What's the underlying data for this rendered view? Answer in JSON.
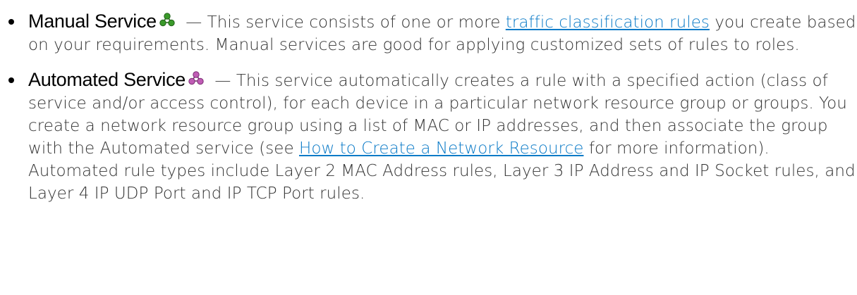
{
  "services": [
    {
      "term": "Manual Service",
      "icon": "manual-service-icon",
      "icon_color": "#3a9a2a",
      "dash": " — ",
      "text_before_link": "This service consists of one or more ",
      "link_text": "traffic classification rules",
      "text_after_link": " you create based on your requirements. Manual services are good for applying customized sets of rules to roles."
    },
    {
      "term": "Automated Service",
      "icon": "automated-service-icon",
      "icon_color": "#b24aa8",
      "dash": " — ",
      "text_before_link": "This service automatically creates a rule with a specified action (class of service and/or access control), for each device in a particular network resource group or groups. You create a network resource group using a list of MAC or IP addresses, and then associate the group with the Automated service (see ",
      "link_text": "How to Create a Network Resource",
      "text_after_link": " for more information). Automated rule types include Layer 2 MAC Address rules, Layer 3 IP Address and IP Socket rules, and Layer 4 IP UDP Port and IP TCP Port rules."
    }
  ],
  "colors": {
    "link": "#0a7ac7",
    "body_text": "#333333",
    "term_text": "#000000"
  }
}
